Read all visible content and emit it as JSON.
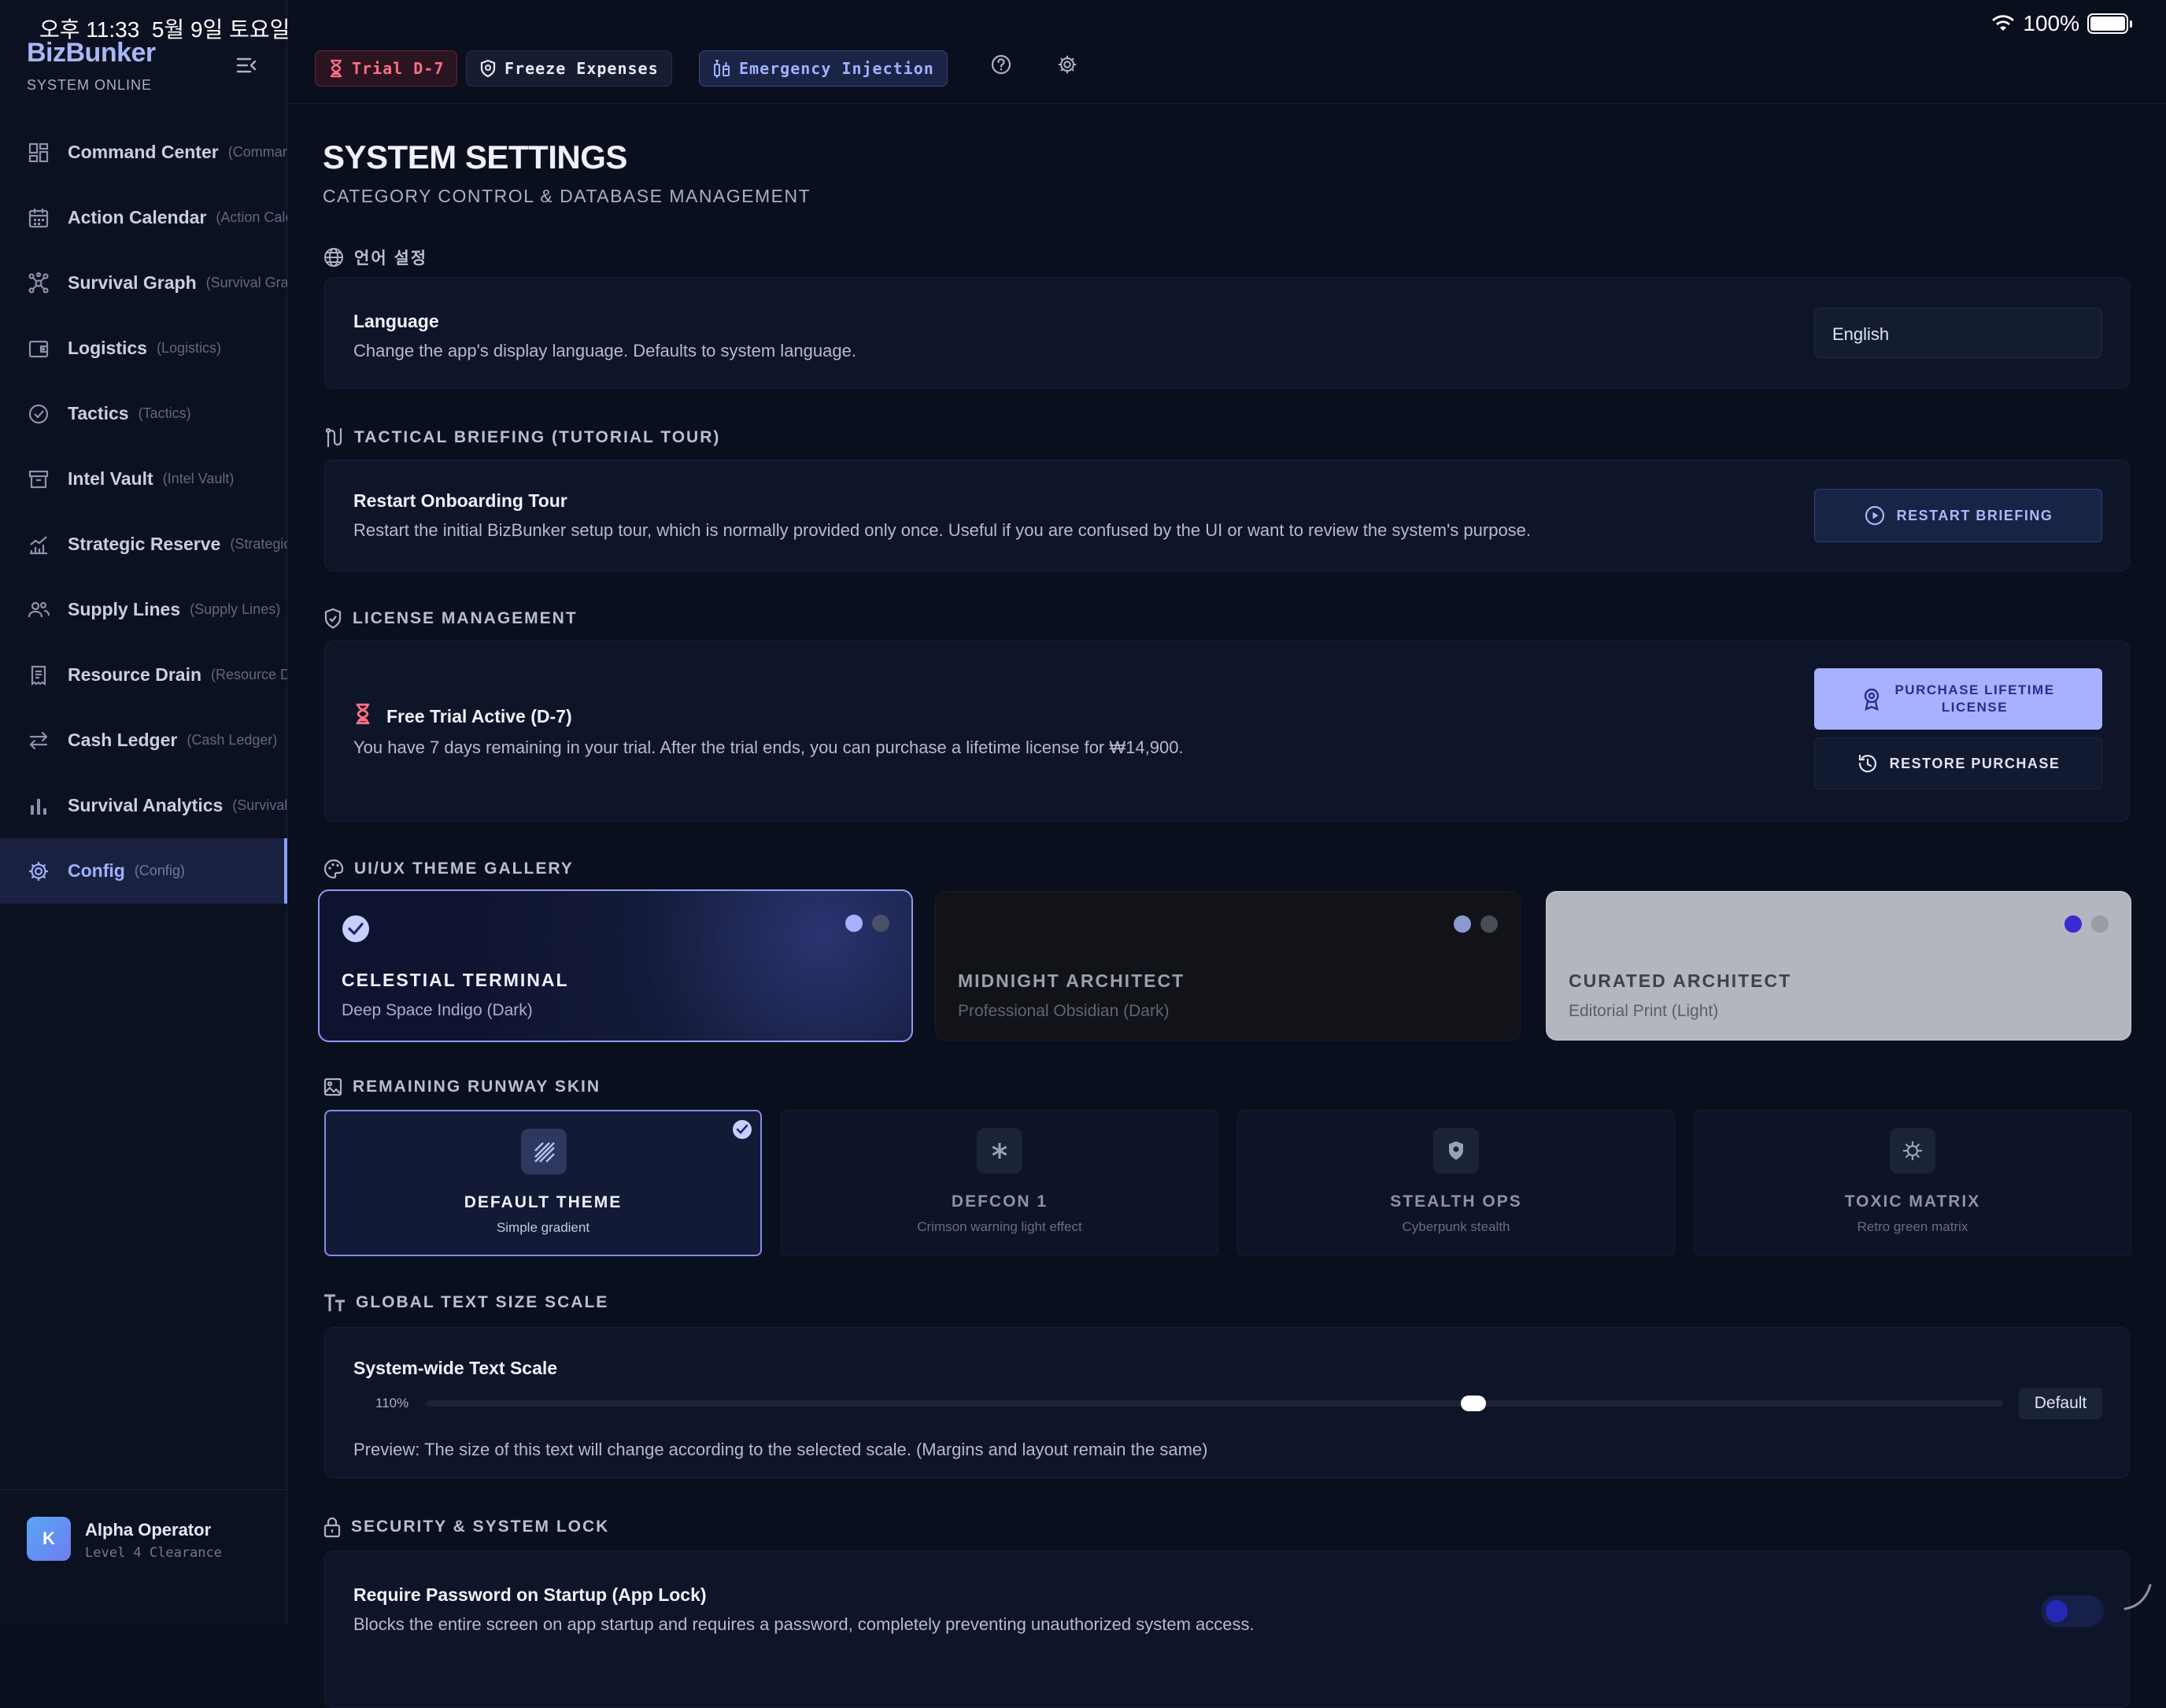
{
  "status": {
    "time": "오후 11:33",
    "date": "5월 9일 토요일",
    "battery": "100%",
    "battery_level": 1.0
  },
  "sidebar": {
    "brand": "BizBunker",
    "subtitle": "SYSTEM ONLINE",
    "items": [
      {
        "label": "Command Center",
        "sub": "(Command Center)",
        "icon": "grid-icon"
      },
      {
        "label": "Action Calendar",
        "sub": "(Action Calendar)",
        "icon": "calendar-icon"
      },
      {
        "label": "Survival Graph",
        "sub": "(Survival Graph)",
        "icon": "graph-icon"
      },
      {
        "label": "Logistics",
        "sub": "(Logistics)",
        "icon": "wallet-icon"
      },
      {
        "label": "Tactics",
        "sub": "(Tactics)",
        "icon": "check-circle-icon"
      },
      {
        "label": "Intel Vault",
        "sub": "(Intel Vault)",
        "icon": "archive-icon"
      },
      {
        "label": "Strategic Reserve",
        "sub": "(Strategic Reserve)",
        "icon": "trend-icon"
      },
      {
        "label": "Supply Lines",
        "sub": "(Supply Lines)",
        "icon": "users-icon"
      },
      {
        "label": "Resource Drain",
        "sub": "(Resource Drain)",
        "icon": "receipt-icon"
      },
      {
        "label": "Cash Ledger",
        "sub": "(Cash Ledger)",
        "icon": "swap-icon"
      },
      {
        "label": "Survival Analytics",
        "sub": "(Survival Analytics)",
        "icon": "bar-chart-icon"
      },
      {
        "label": "Config",
        "sub": "(Config)",
        "icon": "gear-icon"
      }
    ],
    "user": {
      "initial": "K",
      "name": "Alpha Operator",
      "level": "Level 4 Clearance"
    }
  },
  "topbar": {
    "trial": "Trial D-7",
    "freeze": "Freeze Expenses",
    "emergency": "Emergency Injection"
  },
  "page": {
    "title": "SYSTEM SETTINGS",
    "subtitle": "CATEGORY CONTROL & DATABASE MANAGEMENT"
  },
  "language": {
    "section": "언어 설정",
    "title": "Language",
    "desc": "Change the app's display language. Defaults to system language.",
    "value": "English"
  },
  "briefing": {
    "section": "TACTICAL BRIEFING (TUTORIAL TOUR)",
    "title": "Restart Onboarding Tour",
    "desc": "Restart the initial BizBunker setup tour, which is normally provided only once. Useful if you are confused by the UI or want to review the system's purpose.",
    "button": "RESTART BRIEFING"
  },
  "license": {
    "section": "LICENSE MANAGEMENT",
    "title": "Free Trial Active (D-7)",
    "desc": "You have 7 days remaining in your trial. After the trial ends, you can purchase a lifetime license for ₩14,900.",
    "purchase_line1": "PURCHASE LIFETIME",
    "purchase_line2": "LICENSE",
    "restore": "RESTORE PURCHASE"
  },
  "themes": {
    "section": "UI/UX THEME GALLERY",
    "items": [
      {
        "name": "CELESTIAL TERMINAL",
        "desc": "Deep Space Indigo (Dark)",
        "selected": true,
        "dots": [
          "#a6b2ff",
          "#4a5068"
        ]
      },
      {
        "name": "MIDNIGHT ARCHITECT",
        "desc": "Professional Obsidian (Dark)",
        "selected": false,
        "dots": [
          "#8a9ad0",
          "#4a4d57"
        ]
      },
      {
        "name": "CURATED ARCHITECT",
        "desc": "Editorial Print (Light)",
        "selected": false,
        "dots": [
          "#3a2bd0",
          "#9a9ca2"
        ]
      }
    ]
  },
  "runway": {
    "section": "REMAINING RUNWAY SKIN",
    "items": [
      {
        "name": "DEFAULT THEME",
        "desc": "Simple gradient",
        "selected": true
      },
      {
        "name": "DEFCON 1",
        "desc": "Crimson warning light effect",
        "selected": false
      },
      {
        "name": "STEALTH OPS",
        "desc": "Cyberpunk stealth",
        "selected": false
      },
      {
        "name": "TOXIC MATRIX",
        "desc": "Retro green matrix",
        "selected": false
      }
    ]
  },
  "textscale": {
    "section": "GLOBAL TEXT SIZE SCALE",
    "title": "System-wide Text Scale",
    "value": "110%",
    "default_label": "Default",
    "preview": "Preview: The size of this text will change according to the selected scale. (Margins and layout remain the same)"
  },
  "security": {
    "section": "SECURITY & SYSTEM LOCK",
    "title": "Require Password on Startup (App Lock)",
    "desc": "Blocks the entire screen on app startup and requires a password, completely preventing unauthorized system access.",
    "enabled": false
  },
  "colors": {
    "accent": "#a6b2ff",
    "background": "#0a0f1e",
    "trial": "#ff6f84"
  }
}
